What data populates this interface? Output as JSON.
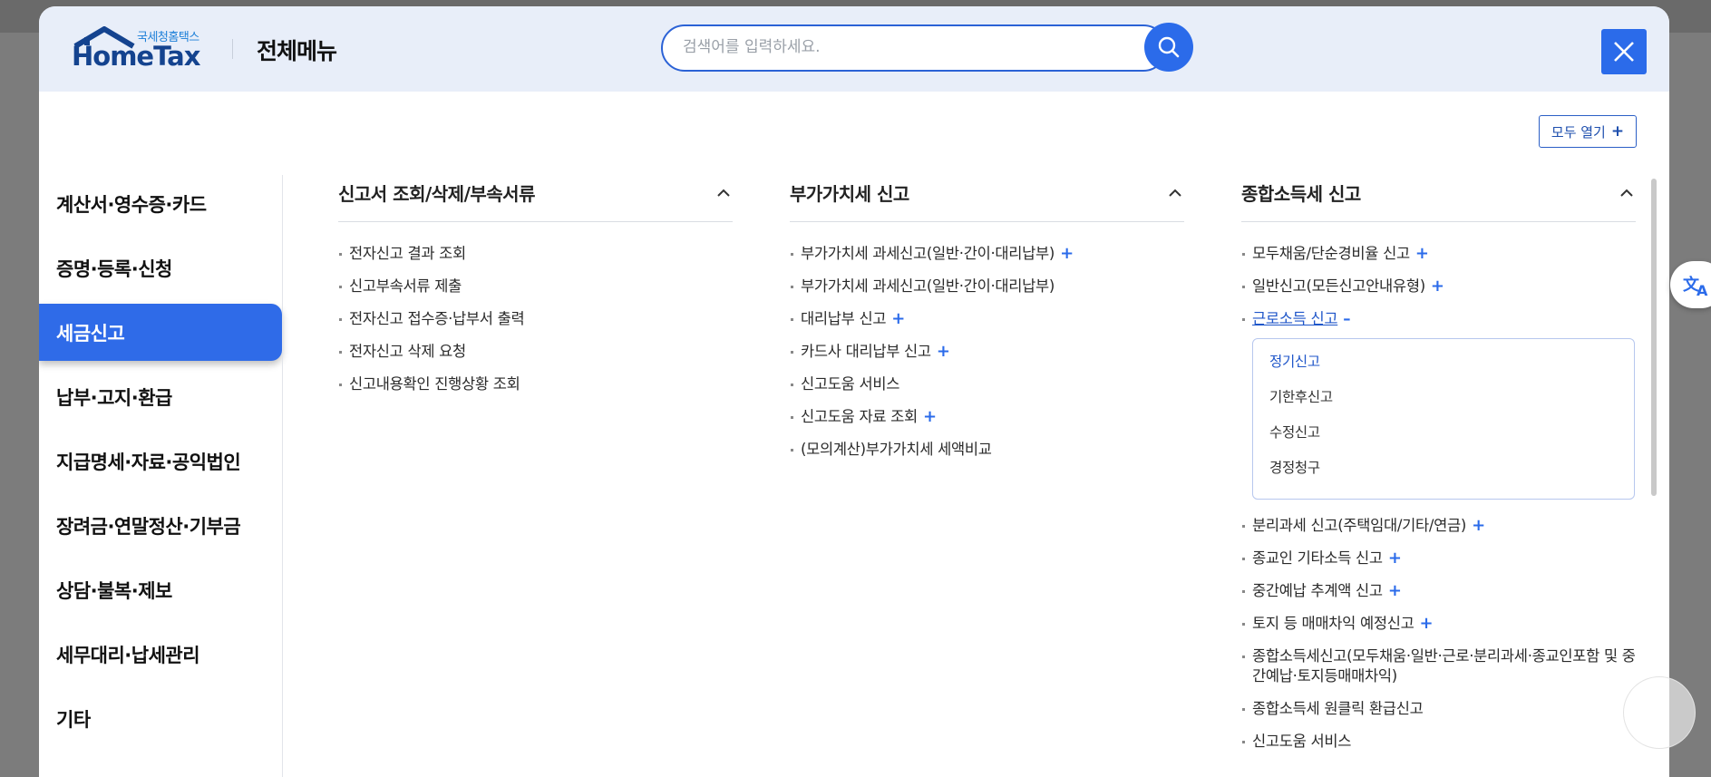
{
  "header": {
    "logo_kor": "국세청홈택스",
    "logo_eng": "HomeTax",
    "title": "전체메뉴",
    "search_placeholder": "검색어를 입력하세요."
  },
  "expand_all_label": "모두 열기",
  "sidebar": {
    "items": [
      {
        "label": "계산서·영수증·카드"
      },
      {
        "label": "증명·등록·신청"
      },
      {
        "label": "세금신고",
        "active": true
      },
      {
        "label": "납부·고지·환급"
      },
      {
        "label": "지급명세·자료·공익법인"
      },
      {
        "label": "장려금·연말정산·기부금"
      },
      {
        "label": "상담·불복·제보"
      },
      {
        "label": "세무대리·납세관리"
      },
      {
        "label": "기타"
      }
    ]
  },
  "columns": [
    {
      "title": "신고서 조회/삭제/부속서류",
      "items": [
        {
          "label": "전자신고 결과 조회"
        },
        {
          "label": "신고부속서류 제출"
        },
        {
          "label": "전자신고 접수증·납부서 출력"
        },
        {
          "label": "전자신고 삭제 요청"
        },
        {
          "label": "신고내용확인 진행상황 조회"
        }
      ]
    },
    {
      "title": "부가가치세 신고",
      "items": [
        {
          "label": "부가가치세 과세신고(일반·간이·대리납부)",
          "expand": "+"
        },
        {
          "label": "부가가치세 과세신고(일반·간이·대리납부)"
        },
        {
          "label": "대리납부 신고",
          "expand": "+"
        },
        {
          "label": "카드사 대리납부 신고",
          "expand": "+"
        },
        {
          "label": "신고도움 서비스"
        },
        {
          "label": "신고도움 자료 조회",
          "expand": "+"
        },
        {
          "label": "(모의계산)부가가치세 세액비교"
        }
      ]
    },
    {
      "title": "종합소득세 신고",
      "items_before": [
        {
          "label": "모두채움/단순경비율 신고",
          "expand": "+"
        },
        {
          "label": "일반신고(모든신고안내유형)",
          "expand": "+"
        }
      ],
      "open_item": {
        "label": "근로소득 신고",
        "expand": "–"
      },
      "submenu": [
        "정기신고",
        "기한후신고",
        "수정신고",
        "경정청구"
      ],
      "items_after": [
        {
          "label": "분리과세 신고(주택임대/기타/연금)",
          "expand": "+"
        },
        {
          "label": "종교인 기타소득 신고",
          "expand": "+"
        },
        {
          "label": "중간예납 추계액 신고",
          "expand": "+"
        },
        {
          "label": "토지 등 매매차익 예정신고",
          "expand": "+"
        },
        {
          "label": "종합소득세신고(모두채움·일반·근로·분리과세·종교인포함 및 중간예납·토지등매매차익)"
        },
        {
          "label": "종합소득세 원클릭 환급신고"
        },
        {
          "label": "신고도움 서비스"
        }
      ]
    }
  ],
  "colors": {
    "accent": "#2b6bea",
    "header_bg": "#e8eef9",
    "logo_navy": "#14438f"
  },
  "icons": [
    "house-roof-logo",
    "search-icon",
    "close-icon",
    "chevron-up-icon",
    "translate-icon"
  ]
}
